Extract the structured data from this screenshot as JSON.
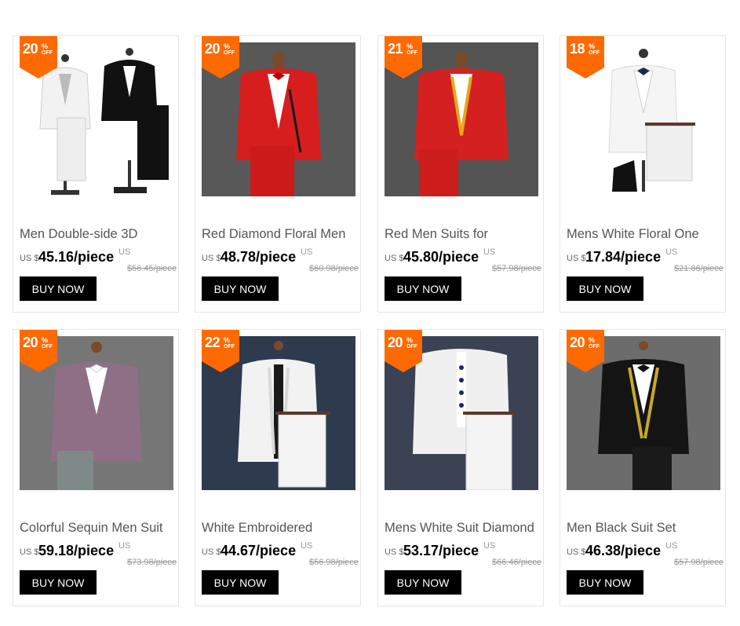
{
  "theme": {
    "badge_color": "#ff6a00",
    "button_bg": "#000000",
    "button_text": "#ffffff"
  },
  "products": [
    {
      "discount": "20",
      "pct": "%",
      "off": "OFF",
      "title": "Men Double-side 3D",
      "currency": "US $",
      "price": "45.16/piece",
      "us_label": "US",
      "old_price": "$56.45/piece",
      "button": "BUY NOW",
      "image": "white-and-black-suits-on-mannequins"
    },
    {
      "discount": "20",
      "pct": "%",
      "off": "OFF",
      "title": "Red Diamond Floral Men",
      "currency": "US $",
      "price": "48.78/piece",
      "us_label": "US",
      "old_price": "$60.98/piece",
      "button": "BUY NOW",
      "image": "red-suit-on-mannequin"
    },
    {
      "discount": "21",
      "pct": "%",
      "off": "OFF",
      "title": "Red Men Suits for",
      "currency": "US $",
      "price": "45.80/piece",
      "us_label": "US",
      "old_price": "$57.98/piece",
      "button": "BUY NOW",
      "image": "red-sequin-suit-on-mannequin"
    },
    {
      "discount": "18",
      "pct": "%",
      "off": "OFF",
      "title": "Mens White Floral One",
      "currency": "US $",
      "price": "17.84/piece",
      "us_label": "US",
      "old_price": "$21.86/piece",
      "button": "BUY NOW",
      "image": "white-floral-suit-on-mannequin"
    },
    {
      "discount": "20",
      "pct": "%",
      "off": "OFF",
      "title": "Colorful Sequin Men Suit",
      "currency": "US $",
      "price": "59.18/piece",
      "us_label": "US",
      "old_price": "$73.98/piece",
      "button": "BUY NOW",
      "image": "purple-sequin-suit-on-mannequin"
    },
    {
      "discount": "22",
      "pct": "%",
      "off": "OFF",
      "title": "White Embroidered",
      "currency": "US $",
      "price": "44.67/piece",
      "us_label": "US",
      "old_price": "$56.98/piece",
      "button": "BUY NOW",
      "image": "white-embroidered-suit-on-mannequin"
    },
    {
      "discount": "20",
      "pct": "%",
      "off": "OFF",
      "title": "Mens White Suit Diamond",
      "currency": "US $",
      "price": "53.17/piece",
      "us_label": "US",
      "old_price": "$66.46/piece",
      "button": "BUY NOW",
      "image": "white-diamond-suit-on-mannequin"
    },
    {
      "discount": "20",
      "pct": "%",
      "off": "OFF",
      "title": "Men Black Suit Set",
      "currency": "US $",
      "price": "46.38/piece",
      "us_label": "US",
      "old_price": "$57.98/piece",
      "button": "BUY NOW",
      "image": "black-gold-suit-on-mannequin"
    }
  ]
}
